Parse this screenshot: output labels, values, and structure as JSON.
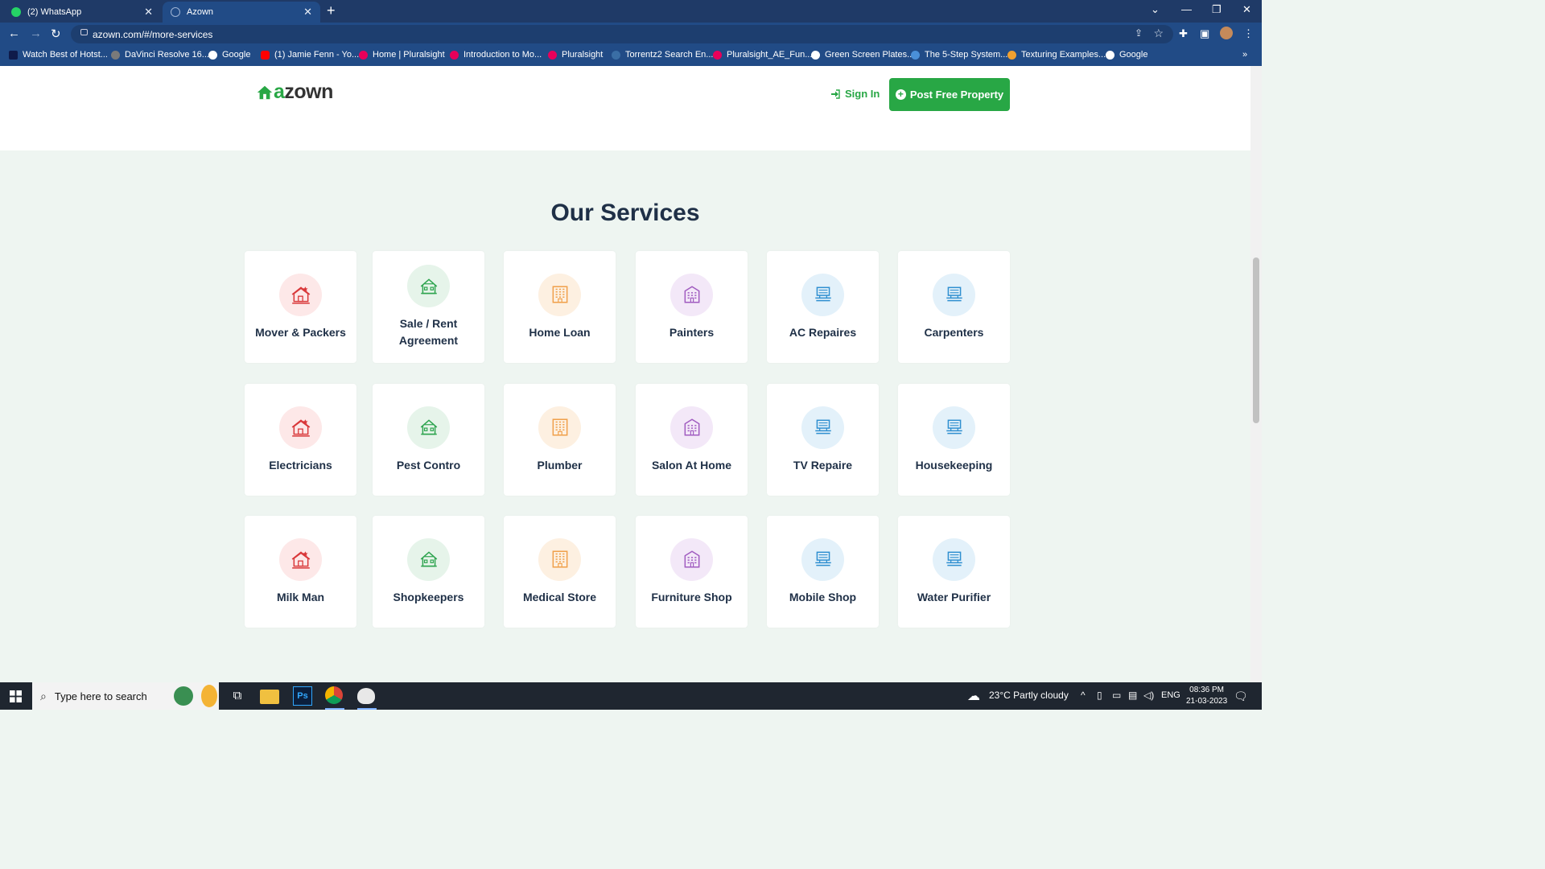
{
  "browser": {
    "tabs": [
      {
        "title": "(2) WhatsApp",
        "active": false,
        "favicon_color": "#25d366"
      },
      {
        "title": "Azown",
        "active": true,
        "favicon_color": "#9fb4d4"
      }
    ],
    "new_tab_icon": "plus-icon",
    "url": "azown.com/#/more-services",
    "bookmarks": [
      {
        "label": "Watch Best of Hotst...",
        "color": "#0f1b4a"
      },
      {
        "label": "DaVinci Resolve 16...",
        "color": "#7a7a7a"
      },
      {
        "label": "Google",
        "color": "#ffffff"
      },
      {
        "label": "(1) Jamie Fenn - Yo...",
        "color": "#ff0000"
      },
      {
        "label": "Home | Pluralsight",
        "color": "#e8005a"
      },
      {
        "label": "Introduction to Mo...",
        "color": "#e8005a"
      },
      {
        "label": "Pluralsight",
        "color": "#e8005a"
      },
      {
        "label": "Torrentz2 Search En...",
        "color": "#3a6ea5"
      },
      {
        "label": "Pluralsight_AE_Fun...",
        "color": "#e8005a"
      },
      {
        "label": "Green Screen Plates...",
        "color": "#ffffff"
      },
      {
        "label": "The 5-Step System...",
        "color": "#4a90d9"
      },
      {
        "label": "Texturing Examples...",
        "color": "#f0a030"
      },
      {
        "label": "Google",
        "color": "#ffffff"
      }
    ],
    "overflow": "»"
  },
  "site": {
    "logo": {
      "prefix": "a",
      "rest": "zown"
    },
    "sign_in": "Sign In",
    "post_property": "Post Free Property"
  },
  "services": {
    "title": "Our Services",
    "items": [
      {
        "label": "Mover & Packers",
        "icon": "house-icon",
        "tone": "red"
      },
      {
        "label": "Sale / Rent Agreement",
        "icon": "villa-icon",
        "tone": "green"
      },
      {
        "label": "Home Loan",
        "icon": "building-icon",
        "tone": "orange"
      },
      {
        "label": "Painters",
        "icon": "apartment-icon",
        "tone": "purple"
      },
      {
        "label": "AC Repaires",
        "icon": "office-icon",
        "tone": "blue"
      },
      {
        "label": "Carpenters",
        "icon": "office-icon",
        "tone": "blue"
      },
      {
        "label": "Electricians",
        "icon": "house-icon",
        "tone": "red"
      },
      {
        "label": "Pest Contro",
        "icon": "villa-icon",
        "tone": "green"
      },
      {
        "label": "Plumber",
        "icon": "building-icon",
        "tone": "orange"
      },
      {
        "label": "Salon At Home",
        "icon": "apartment-icon",
        "tone": "purple"
      },
      {
        "label": "TV Repaire",
        "icon": "office-icon",
        "tone": "blue"
      },
      {
        "label": "Housekeeping",
        "icon": "office-icon",
        "tone": "blue"
      },
      {
        "label": "Milk Man",
        "icon": "house-icon",
        "tone": "red"
      },
      {
        "label": "Shopkeepers",
        "icon": "villa-icon",
        "tone": "green"
      },
      {
        "label": "Medical Store",
        "icon": "building-icon",
        "tone": "orange"
      },
      {
        "label": "Furniture Shop",
        "icon": "apartment-icon",
        "tone": "purple"
      },
      {
        "label": "Mobile Shop",
        "icon": "office-icon",
        "tone": "blue"
      },
      {
        "label": "Water Purifier",
        "icon": "office-icon",
        "tone": "blue"
      }
    ],
    "tones": {
      "red": {
        "bg": "#fde8e8",
        "fg": "#d9383a"
      },
      "green": {
        "bg": "#e6f4ea",
        "fg": "#2ea44f"
      },
      "orange": {
        "bg": "#fdf0e1",
        "fg": "#f0a04b"
      },
      "purple": {
        "bg": "#f3e8f8",
        "fg": "#a05cc0"
      },
      "blue": {
        "bg": "#e3f1fa",
        "fg": "#2f8fd0"
      }
    }
  },
  "taskbar": {
    "search_placeholder": "Type here to search",
    "weather": "23°C  Partly cloudy",
    "language": "ENG",
    "time": "08:36 PM",
    "date": "21-03-2023"
  }
}
